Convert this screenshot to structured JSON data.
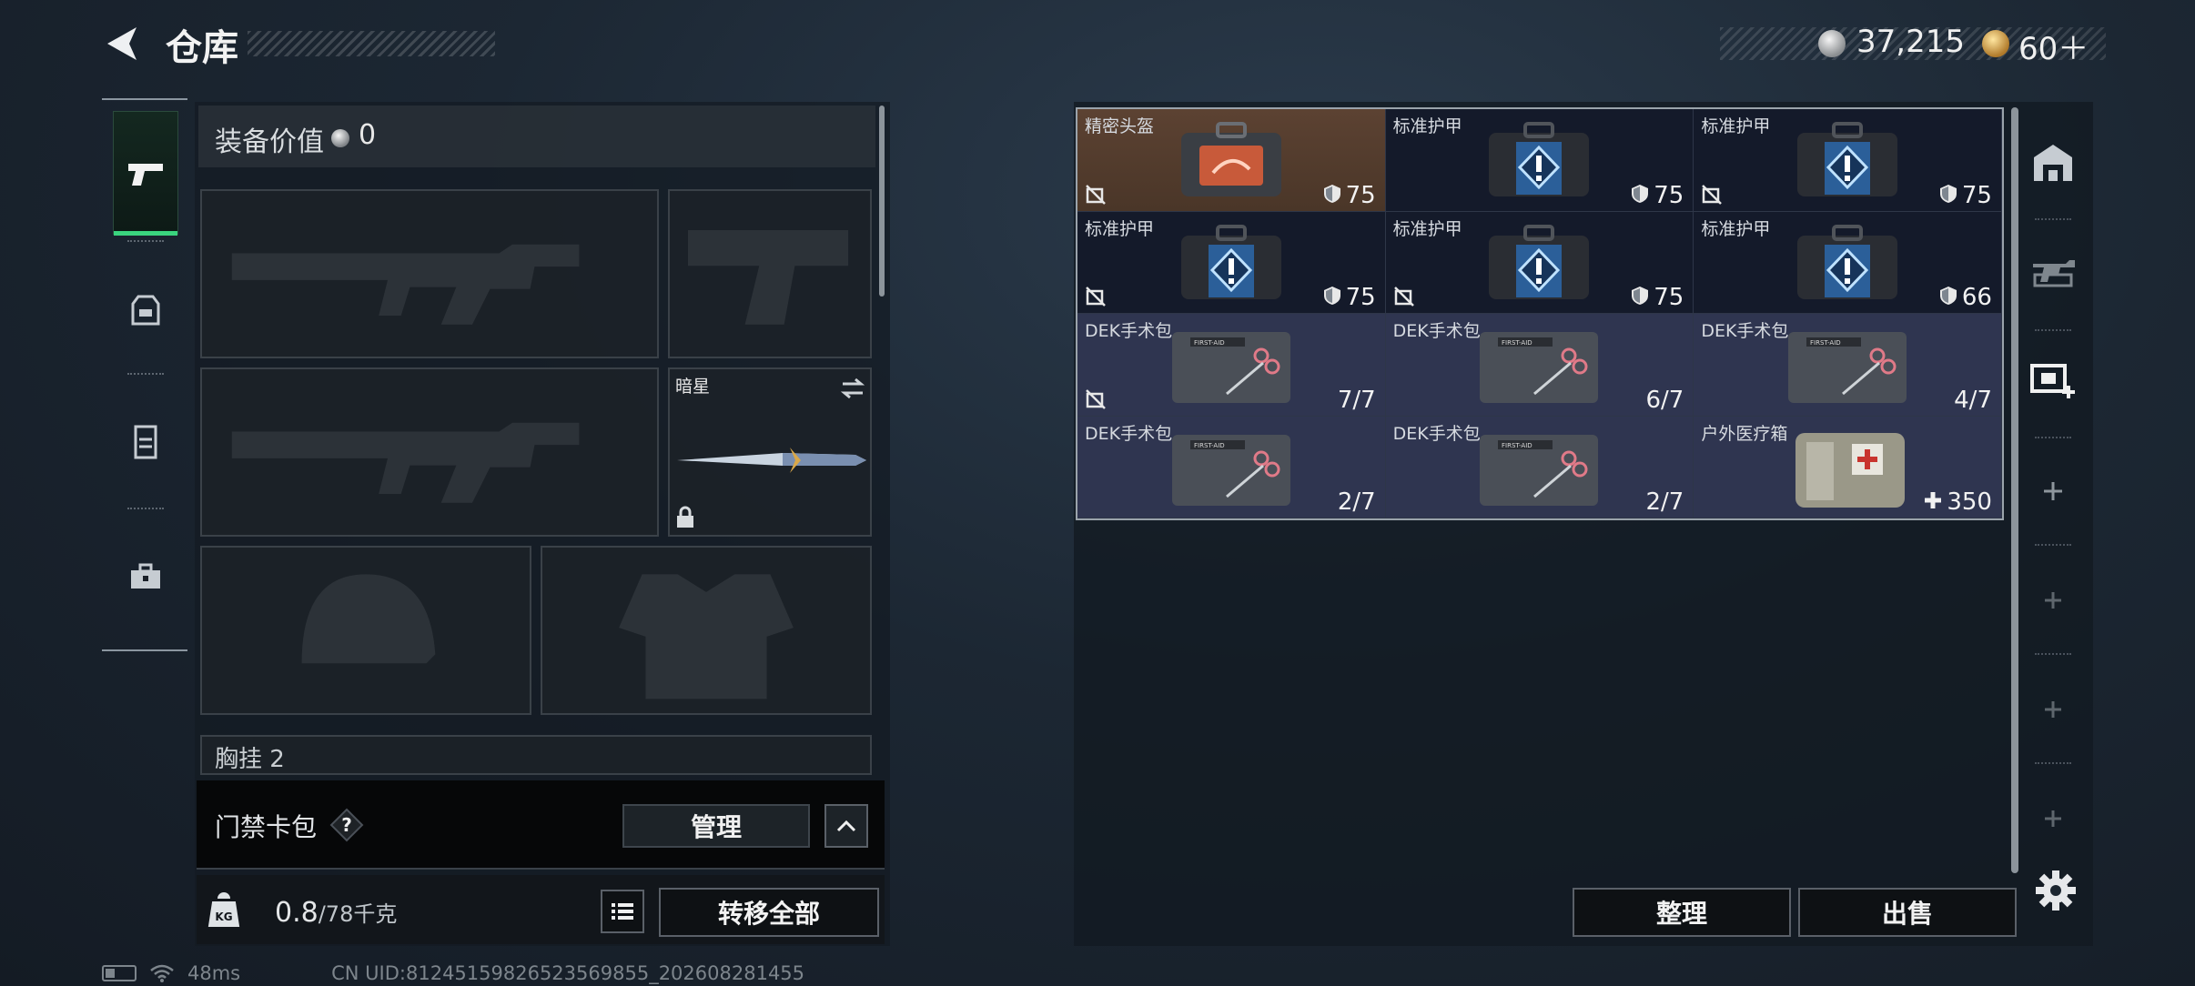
{
  "header": {
    "title": "仓库"
  },
  "currency": {
    "coins": "37,215",
    "premium": "60＋"
  },
  "loadout": {
    "value_label": "装备价值",
    "value": "0",
    "knife_name": "暗星",
    "chest_label": "胸挂",
    "chest_value": "2"
  },
  "access_card": {
    "label": "门禁卡包",
    "help": "?",
    "manage_label": "管理"
  },
  "weight": {
    "current": "0.8",
    "max_unit": "/78千克"
  },
  "actions": {
    "transfer_all": "转移全部",
    "sort": "整理",
    "sell": "出售"
  },
  "items": [
    {
      "name": "精密头盔",
      "value": "75",
      "kind": "helmet",
      "rarity": "rare",
      "marker": "shield",
      "locked": true
    },
    {
      "name": "标准护甲",
      "value": "75",
      "kind": "armor",
      "rarity": "normal",
      "marker": "shield",
      "locked": false
    },
    {
      "name": "标准护甲",
      "value": "75",
      "kind": "armor",
      "rarity": "normal",
      "marker": "shield",
      "locked": true
    },
    {
      "name": "标准护甲",
      "value": "75",
      "kind": "armor",
      "rarity": "normal",
      "marker": "shield",
      "locked": true
    },
    {
      "name": "标准护甲",
      "value": "75",
      "kind": "armor",
      "rarity": "normal",
      "marker": "shield",
      "locked": true
    },
    {
      "name": "标准护甲",
      "value": "66",
      "kind": "armor",
      "rarity": "normal",
      "marker": "shield",
      "locked": false
    },
    {
      "name": "DEK手术包",
      "value": "7/7",
      "kind": "surgery",
      "rarity": "med",
      "marker": "none",
      "locked": true
    },
    {
      "name": "DEK手术包",
      "value": "6/7",
      "kind": "surgery",
      "rarity": "med",
      "marker": "none",
      "locked": false
    },
    {
      "name": "DEK手术包",
      "value": "4/7",
      "kind": "surgery",
      "rarity": "med",
      "marker": "none",
      "locked": false
    },
    {
      "name": "DEK手术包",
      "value": "2/7",
      "kind": "surgery",
      "rarity": "med",
      "marker": "none",
      "locked": false
    },
    {
      "name": "DEK手术包",
      "value": "2/7",
      "kind": "surgery",
      "rarity": "med",
      "marker": "none",
      "locked": false
    },
    {
      "name": "户外医疗箱",
      "value": "350",
      "kind": "medkit",
      "rarity": "med",
      "marker": "plus",
      "locked": false
    }
  ],
  "status": {
    "ping": "48ms",
    "uid": "CN UID:81245159826523569855_202608281455"
  },
  "colors": {
    "accent_green": "#3ad47e",
    "rare_bg": "#5c4232",
    "med_bg": "#2f3550",
    "armor_bg": "#141a2a"
  }
}
